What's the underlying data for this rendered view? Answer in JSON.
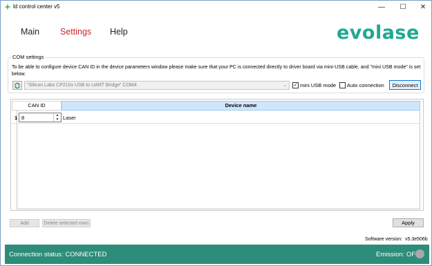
{
  "window": {
    "title": "ld control center v5",
    "minimize": "—",
    "maximize": "☐",
    "close": "✕"
  },
  "menu": {
    "main": "Main",
    "settings": "Settings",
    "help": "Help",
    "active": "Settings"
  },
  "brand": {
    "logo_text": "evolase",
    "color": "#20a892"
  },
  "com_settings": {
    "group_label": "COM settings",
    "info_text": "To be able to configure device CAN ID in the device parameters window please make sure that your PC is connected directly to driver board via mini-USB cable, and \"mini USB mode\" is set below.",
    "port_value": "\"Silicon Labs CP210x USB to UART Bridge\" COM4",
    "mini_usb_label": "mini USB mode",
    "mini_usb_checked": true,
    "auto_connection_label": "Auto connection",
    "auto_connection_checked": false,
    "disconnect_label": "Disconnect"
  },
  "table": {
    "columns": [
      "CAN ID",
      "Device name"
    ],
    "rows": [
      {
        "index": "1",
        "can_id": "8",
        "device_name": "Laser"
      }
    ]
  },
  "buttons": {
    "add": "Add",
    "delete_rows": "Delete selected rows",
    "apply": "Apply"
  },
  "software": {
    "version_label": "Software version:",
    "version_value": "v5.3e506b"
  },
  "status_bar": {
    "connection_label": "Connection status:",
    "connection_value": "CONNECTED",
    "emission_label": "Emission:",
    "emission_value": "OFF",
    "bar_color": "#2d8c7a",
    "led_color": "#a9a9a9"
  }
}
